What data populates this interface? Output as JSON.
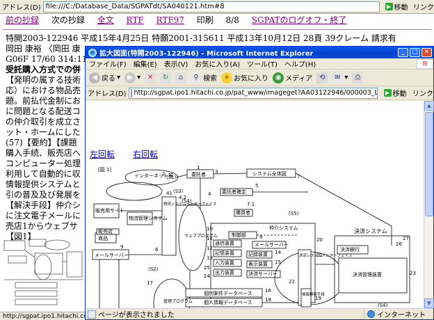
{
  "background": {
    "address_label": "アドレス(D)",
    "address_url": "file:///C:/Database_Data/SGPATdt/SA040121.htm#8",
    "go_label": "移動",
    "links_label": "リンク",
    "nav": {
      "prev": "前の抄録",
      "next": "次の抄録",
      "fulltext": "全文",
      "rtf": "RTF",
      "rtf97": "RTF97",
      "print": "印刷",
      "page": "8/8",
      "logoff": "SGPATのログオフ・終了"
    },
    "lines": [
      "特開2003-122946 平成15年4月25日 特願2001-315611 平成13年10月12日 28頁 39クレーム 請求有",
      "岡田 康裕  〈岡田 康",
      "G06F 17/60 314:114",
      "受託購入方式での併",
      "【発明の属する技術",
      "応）における物品売",
      "題。前払代金制にお",
      "に問題となる配送コ",
      "の仲介取引を成立さ",
      "ット・ホームにした",
      "(57)【要約】【課題",
      "購入手続、販売店へ",
      "コンピューター処理",
      "利用して自動的に収",
      "情報提供システムと",
      "引の普及及び発展を",
      "【解決手段】仲介シ",
      "に注文電子メールに",
      "売店1からウェブサ",
      "【図1】"
    ],
    "status_text": "http://sgpat.ipo1.hitachi.co"
  },
  "popup": {
    "title": "拡大図面(特開2003-122946) - Microsoft Internet Explorer",
    "menu": [
      "ファイル(F)",
      "編集(E)",
      "表示(V)",
      "お気に入り(A)",
      "ツール(T)",
      "ヘルプ(H)"
    ],
    "toolbar": {
      "back": "戻る",
      "search": "検索",
      "favorites": "お気に入り",
      "media": "メディア"
    },
    "address_label": "アドレス(D)",
    "address_url": "http://sgpat.ipo1.hitachi.co.jp/pat_www/imageget?AA03122946/000003_L.gif",
    "go_label": "移動",
    "links_label": "リンク",
    "rotate_left": "左回転",
    "rotate_right": "右回転",
    "status_text": "ページが表示されました",
    "zone_text": "インターネット"
  },
  "figure": {
    "fig_label": "[図 1]",
    "system_label": "システム全体図",
    "internet": "インターネット等",
    "consignor": "委託者",
    "consign_confirm": "委託者確定",
    "buyer": "購買者",
    "sales_site": "販売用サイト",
    "goods_mgmt": "物流管理システム",
    "goods": "商品",
    "store": "販売店",
    "mail_server": "メールサーバー",
    "interface": "物流システムインターフェイス",
    "web_program": "ウェブプログラム",
    "broker_system": "仲介システム",
    "control": "制御部",
    "comm": "通信装置",
    "memory": "記憶装置",
    "input": "入力装置",
    "output": "出力装置",
    "mail_server2": "メールサーバー",
    "record": "記録装置",
    "display": "表示装置",
    "settle_server": "決済サーバー",
    "settle_if": "決済システムインターフェイス",
    "settle_system": "決済システム",
    "settle_bank": "決済銀行",
    "settle_mgmt": "決済管理装置",
    "mgmt_program": "管理プログラム",
    "db_individual": "個別案件データベース",
    "db_personal": "個人情報データベース",
    "db_goods": "商品情報データベース",
    "db_store": "販売店情報データベース",
    "db_total": "総合情報データベース",
    "info_search": "情報検索手段",
    "s_labels": [
      "(S1)",
      "(S3)",
      "(S4)",
      "(S2)",
      "(S5)",
      "(S4)"
    ],
    "nums": [
      "2",
      "3",
      "1",
      "4",
      "41",
      "4.2",
      "5",
      "7",
      "7.1",
      "17",
      "11",
      "12",
      "13",
      "10",
      "8",
      "20",
      "21",
      "22",
      "23",
      "24",
      "25",
      "26",
      "27",
      "14",
      "15",
      "16",
      "18",
      "19",
      "6",
      "9"
    ]
  }
}
